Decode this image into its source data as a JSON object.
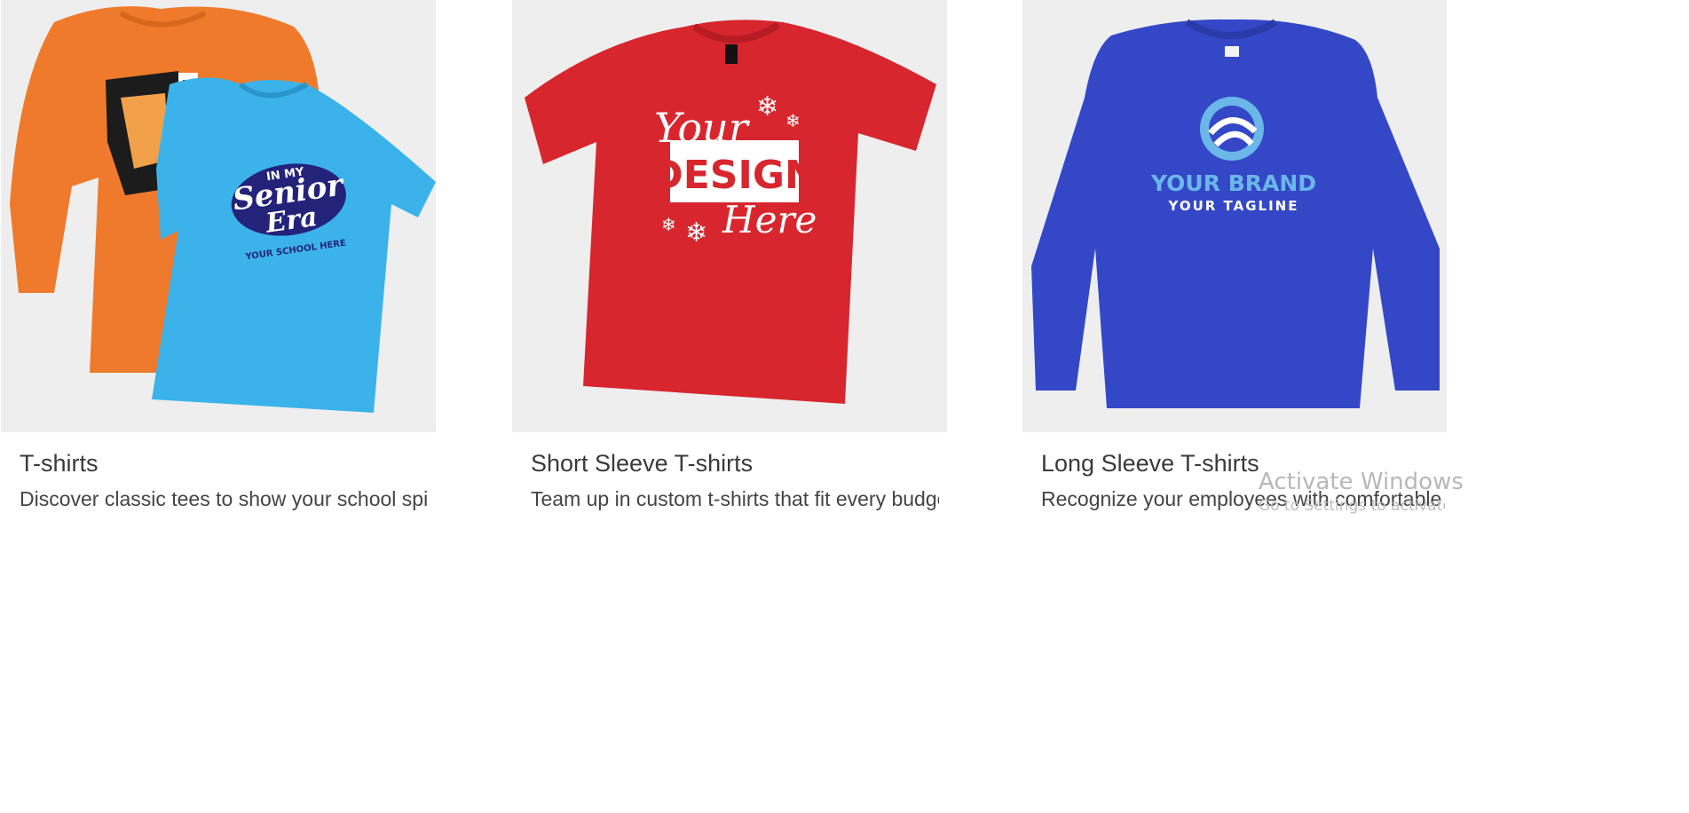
{
  "products": [
    {
      "title": "T-shirts",
      "description": "Discover classic tees to show your school spirit or staff",
      "image": {
        "icon": "orange-and-blue-tshirts-image",
        "shirt_colors": [
          "#ef7a2c",
          "#3bb3ea"
        ],
        "print_lines": [
          "IN MY",
          "Senior",
          "Era",
          "YOUR SCHOOL HERE"
        ]
      }
    },
    {
      "title": "Short Sleeve T-shirts",
      "description": "Team up in custom t-shirts that fit every budget",
      "image": {
        "icon": "red-tshirt-image",
        "shirt_colors": [
          "#d7262e"
        ],
        "print_lines": [
          "Your",
          "DESIGN",
          "Here"
        ]
      }
    },
    {
      "title": "Long Sleeve T-shirts",
      "description": "Recognize your employees with comfortable custom long sleeves",
      "image": {
        "icon": "blue-long-sleeve-image",
        "shirt_colors": [
          "#3448c7"
        ],
        "print_lines": [
          "YOUR BRAND",
          "YOUR TAGLINE"
        ]
      }
    }
  ],
  "watermark": {
    "title": "Activate Windows",
    "subtitle": "Go to Settings to activate Windows."
  }
}
